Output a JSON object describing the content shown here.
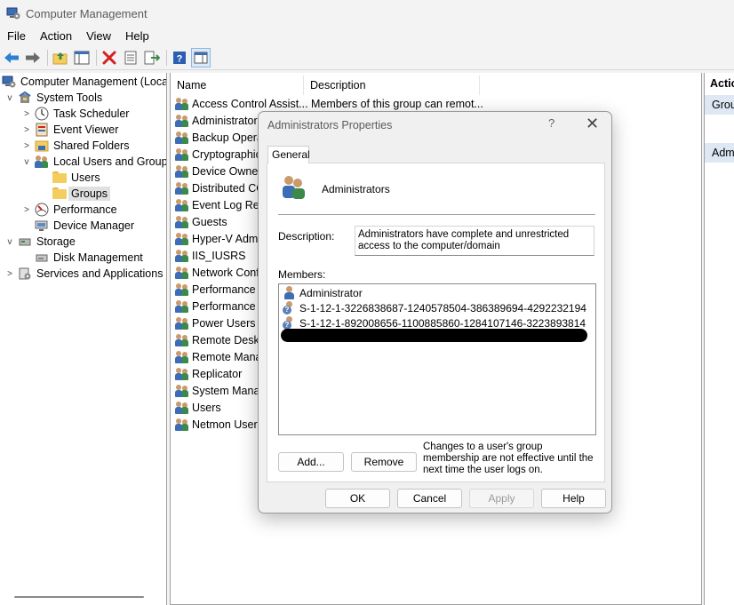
{
  "window": {
    "title": "Computer Management"
  },
  "menu": [
    "File",
    "Action",
    "View",
    "Help"
  ],
  "tree": [
    {
      "label": "Computer Management (Local",
      "icon": "computer-management-icon",
      "expander": ""
    },
    {
      "label": "System Tools",
      "icon": "system-tools-icon",
      "expander": "v"
    },
    {
      "label": "Task Scheduler",
      "icon": "clock-icon",
      "expander": ">"
    },
    {
      "label": "Event Viewer",
      "icon": "event-viewer-icon",
      "expander": ">"
    },
    {
      "label": "Shared Folders",
      "icon": "shared-folder-icon",
      "expander": ">"
    },
    {
      "label": "Local Users and Groups",
      "icon": "users-groups-icon",
      "expander": "v"
    },
    {
      "label": "Users",
      "icon": "folder-icon",
      "expander": ""
    },
    {
      "label": "Groups",
      "icon": "folder-icon",
      "expander": ""
    },
    {
      "label": "Performance",
      "icon": "performance-icon",
      "expander": ">"
    },
    {
      "label": "Device Manager",
      "icon": "device-manager-icon",
      "expander": ""
    },
    {
      "label": "Storage",
      "icon": "storage-icon",
      "expander": "v"
    },
    {
      "label": "Disk Management",
      "icon": "disk-icon",
      "expander": ""
    },
    {
      "label": "Services and Applications",
      "icon": "services-icon",
      "expander": ">"
    }
  ],
  "list": {
    "columns": [
      "Name",
      "Description"
    ],
    "rows": [
      {
        "name": "Access Control Assist...",
        "desc": "Members of this group can remot..."
      },
      {
        "name": "Administrators",
        "desc": ""
      },
      {
        "name": "Backup Operat",
        "desc": ""
      },
      {
        "name": "Cryptographic",
        "desc": ""
      },
      {
        "name": "Device Owners",
        "desc": ""
      },
      {
        "name": "Distributed CO",
        "desc": ""
      },
      {
        "name": "Event Log Rea",
        "desc": ""
      },
      {
        "name": "Guests",
        "desc": ""
      },
      {
        "name": "Hyper-V Admi",
        "desc": ""
      },
      {
        "name": "IIS_IUSRS",
        "desc": ""
      },
      {
        "name": "Network Confi",
        "desc": ""
      },
      {
        "name": "Performance L",
        "desc": ""
      },
      {
        "name": "Performance M",
        "desc": ""
      },
      {
        "name": "Power Users",
        "desc": ""
      },
      {
        "name": "Remote Deskt",
        "desc": ""
      },
      {
        "name": "Remote Manag",
        "desc": ""
      },
      {
        "name": "Replicator",
        "desc": ""
      },
      {
        "name": "System Manag",
        "desc": ""
      },
      {
        "name": "Users",
        "desc": ""
      },
      {
        "name": "Netmon Users",
        "desc": ""
      }
    ]
  },
  "actions": {
    "title": "Actio",
    "band1": "Grou",
    "band2": "Adm"
  },
  "dialog": {
    "title": "Administrators Properties",
    "help": "?",
    "close": "✕",
    "tab": "General",
    "group_name": "Administrators",
    "description_label": "Description:",
    "description": "Administrators have complete and unrestricted access to the computer/domain",
    "members_label": "Members:",
    "members": [
      {
        "name": "Administrator",
        "icon": "user-icon"
      },
      {
        "name": "S-1-12-1-3226838687-1240578504-386389694-4292232194",
        "icon": "unknown-account-icon"
      },
      {
        "name": "S-1-12-1-892008656-1100885860-1284107146-3223893814",
        "icon": "unknown-account-icon"
      }
    ],
    "add_label": "Add...",
    "remove_label": "Remove",
    "note": "Changes to a user's group membership are not effective until the next time the user logs on.",
    "ok_label": "OK",
    "cancel_label": "Cancel",
    "apply_label": "Apply",
    "help_label": "Help"
  },
  "colors": {
    "accent": "#3c6db5",
    "selection": "#dde8f4",
    "titlebar": "#f3f3f3"
  }
}
